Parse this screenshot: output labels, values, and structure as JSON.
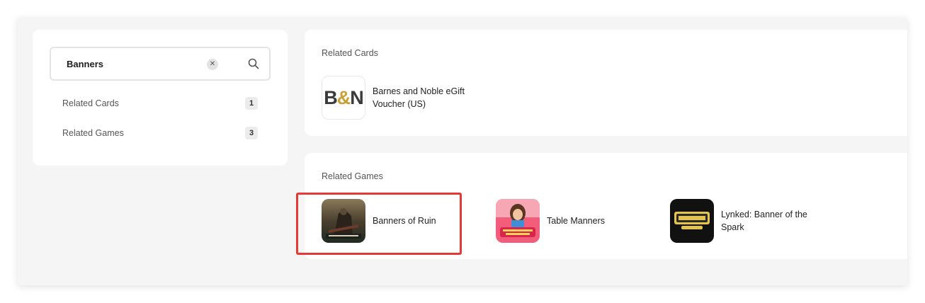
{
  "search": {
    "value": "Banners"
  },
  "sidebar": {
    "items": [
      {
        "label": "Related Cards",
        "count": "1"
      },
      {
        "label": "Related Games",
        "count": "3"
      }
    ]
  },
  "cards_section": {
    "title": "Related Cards",
    "items": [
      {
        "name": "Barnes and Noble eGift Voucher (US)",
        "logo_text_left": "B",
        "logo_text_amp": "&",
        "logo_text_right": "N"
      }
    ]
  },
  "games_section": {
    "title": "Related Games",
    "items": [
      {
        "name": "Banners of Ruin",
        "selected": true
      },
      {
        "name": "Table Manners"
      },
      {
        "name": "Lynked: Banner of the Spark"
      }
    ]
  },
  "colors": {
    "highlight": "#e53935",
    "bn_gold": "#c8a033"
  },
  "icons": [
    "clear-icon",
    "search-icon"
  ]
}
